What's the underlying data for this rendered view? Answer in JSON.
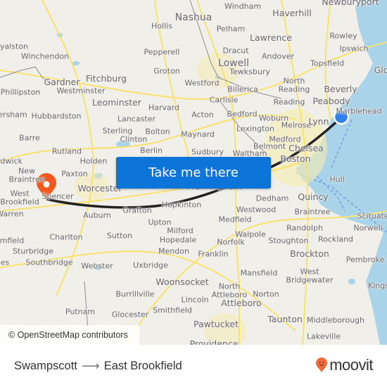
{
  "map": {
    "colors": {
      "land": "#f1efe9",
      "water": "#a9d3e8",
      "road": "#f7e36b",
      "route": "#222222",
      "origin": "#2f80ed",
      "destination": "#f2581e",
      "cta": "#0d74d9",
      "brand": "#f26b3a"
    },
    "places": [
      {
        "name": "Windham",
        "size": "s"
      },
      {
        "name": "Haverhill",
        "size": "m"
      },
      {
        "name": "Newburyport",
        "size": "m"
      },
      {
        "name": "Nashua",
        "size": "l"
      },
      {
        "name": "Hollis",
        "size": "s"
      },
      {
        "name": "Pelham",
        "size": "s"
      },
      {
        "name": "Lawrence",
        "size": "m"
      },
      {
        "name": "Rowley",
        "size": "s"
      },
      {
        "name": "Ipswich",
        "size": "s"
      },
      {
        "name": "yalston",
        "size": "s"
      },
      {
        "name": "Winchendon",
        "size": "s"
      },
      {
        "name": "Pepperell",
        "size": "s"
      },
      {
        "name": "Dracut",
        "size": "s"
      },
      {
        "name": "Andover",
        "size": "s"
      },
      {
        "name": "Topsfield",
        "size": "s"
      },
      {
        "name": "Glo",
        "size": "m"
      },
      {
        "name": "Gardner",
        "size": "m"
      },
      {
        "name": "Fitchburg",
        "size": "m"
      },
      {
        "name": "Groton",
        "size": "s"
      },
      {
        "name": "Lowell",
        "size": "l"
      },
      {
        "name": "Tewksbury",
        "size": "s"
      },
      {
        "name": "Westminster",
        "size": "s"
      },
      {
        "name": "Phillipston",
        "size": "s"
      },
      {
        "name": "Westford",
        "size": "s"
      },
      {
        "name": "Billerica",
        "size": "s"
      },
      {
        "name": "North Reading",
        "size": "s"
      },
      {
        "name": "Beverly",
        "size": "m"
      },
      {
        "name": "Leominster",
        "size": "m"
      },
      {
        "name": "Carlisle",
        "size": "s"
      },
      {
        "name": "Reading",
        "size": "s"
      },
      {
        "name": "Peabody",
        "size": "m"
      },
      {
        "name": "Harvard",
        "size": "s"
      },
      {
        "name": "Marblehead",
        "size": "s"
      },
      {
        "name": "ersham",
        "size": "s"
      },
      {
        "name": "Hubbardston",
        "size": "s"
      },
      {
        "name": "Lancaster",
        "size": "s"
      },
      {
        "name": "Acton",
        "size": "s"
      },
      {
        "name": "Bedford",
        "size": "s"
      },
      {
        "name": "Woburn",
        "size": "s"
      },
      {
        "name": "Melrose",
        "size": "s"
      },
      {
        "name": "Lynn",
        "size": "m"
      },
      {
        "name": "Sterling",
        "size": "s"
      },
      {
        "name": "Bolton",
        "size": "s"
      },
      {
        "name": "Maynard",
        "size": "s"
      },
      {
        "name": "Lexington",
        "size": "s"
      },
      {
        "name": "Clinton",
        "size": "s"
      },
      {
        "name": "Medford",
        "size": "s"
      },
      {
        "name": "Barre",
        "size": "s"
      },
      {
        "name": "Berlin",
        "size": "s"
      },
      {
        "name": "Sudbury",
        "size": "s"
      },
      {
        "name": "Waltham",
        "size": "s"
      },
      {
        "name": "Belmont",
        "size": "s"
      },
      {
        "name": "Chelsea",
        "size": "m"
      },
      {
        "name": "Rutland",
        "size": "s"
      },
      {
        "name": "rdwick",
        "size": "s"
      },
      {
        "name": "Holden",
        "size": "s"
      },
      {
        "name": "Boston",
        "size": "m"
      },
      {
        "name": "New Braintree",
        "size": "s"
      },
      {
        "name": "Paxton",
        "size": "s"
      },
      {
        "name": "Worcester",
        "size": "m"
      },
      {
        "name": "Framingham",
        "size": "m"
      },
      {
        "name": "Hull",
        "size": "s"
      },
      {
        "name": "West Brookfield",
        "size": "s"
      },
      {
        "name": "Spencer",
        "size": "s"
      },
      {
        "name": "Dedham",
        "size": "s"
      },
      {
        "name": "Quincy",
        "size": "m"
      },
      {
        "name": "Hopkinton",
        "size": "s"
      },
      {
        "name": "Grafton",
        "size": "s"
      },
      {
        "name": "Auburn",
        "size": "s"
      },
      {
        "name": "Westwood",
        "size": "s"
      },
      {
        "name": "Braintree",
        "size": "s"
      },
      {
        "name": "Warren",
        "size": "s"
      },
      {
        "name": "Medfield",
        "size": "s"
      },
      {
        "name": "Scituate",
        "size": "s"
      },
      {
        "name": "Sutton",
        "size": "s"
      },
      {
        "name": "Upton",
        "size": "s"
      },
      {
        "name": "Charlton",
        "size": "s"
      },
      {
        "name": "Milford",
        "size": "s"
      },
      {
        "name": "Walpole",
        "size": "s"
      },
      {
        "name": "Randolph",
        "size": "s"
      },
      {
        "name": "Norwell",
        "size": "s"
      },
      {
        "name": "mfield",
        "size": "s"
      },
      {
        "name": "Hopedale",
        "size": "s"
      },
      {
        "name": "Norfolk",
        "size": "s"
      },
      {
        "name": "Stoughton",
        "size": "s"
      },
      {
        "name": "Rockland",
        "size": "s"
      },
      {
        "name": "Sturbridge",
        "size": "s"
      },
      {
        "name": "Mendon",
        "size": "s"
      },
      {
        "name": "Franklin",
        "size": "s"
      },
      {
        "name": "es",
        "size": "s"
      },
      {
        "name": "Southbridge",
        "size": "s"
      },
      {
        "name": "Brockton",
        "size": "m"
      },
      {
        "name": "Webster",
        "size": "s"
      },
      {
        "name": "Uxbridge",
        "size": "s"
      },
      {
        "name": "Pembroke",
        "size": "s"
      },
      {
        "name": "Mansfield",
        "size": "s"
      },
      {
        "name": "West Bridgewater",
        "size": "s"
      },
      {
        "name": "Burrillville",
        "size": "s"
      },
      {
        "name": "Woonsocket",
        "size": "m"
      },
      {
        "name": "North Attleboro",
        "size": "s"
      },
      {
        "name": "Norton",
        "size": "s"
      },
      {
        "name": "Kings",
        "size": "s"
      },
      {
        "name": "Lincoln",
        "size": "s"
      },
      {
        "name": "Attleboro",
        "size": "m"
      },
      {
        "name": "Putnam",
        "size": "s"
      },
      {
        "name": "Glocester",
        "size": "s"
      },
      {
        "name": "Smithfield",
        "size": "s"
      },
      {
        "name": "Taunton",
        "size": "m"
      },
      {
        "name": "Middleborough",
        "size": "s"
      },
      {
        "name": "Pawtucket",
        "size": "m"
      },
      {
        "name": "Lakeville",
        "size": "s"
      },
      {
        "name": "Providence",
        "size": "m"
      }
    ],
    "origin_marker": "origin-dot",
    "destination_marker": "destination-pin",
    "cta_label": "Take me there",
    "attribution": "© OpenStreetMap contributors"
  },
  "footer": {
    "origin": "Swampscott",
    "arrow": "⟶",
    "destination": "East Brookfield",
    "brand": "moovit"
  }
}
